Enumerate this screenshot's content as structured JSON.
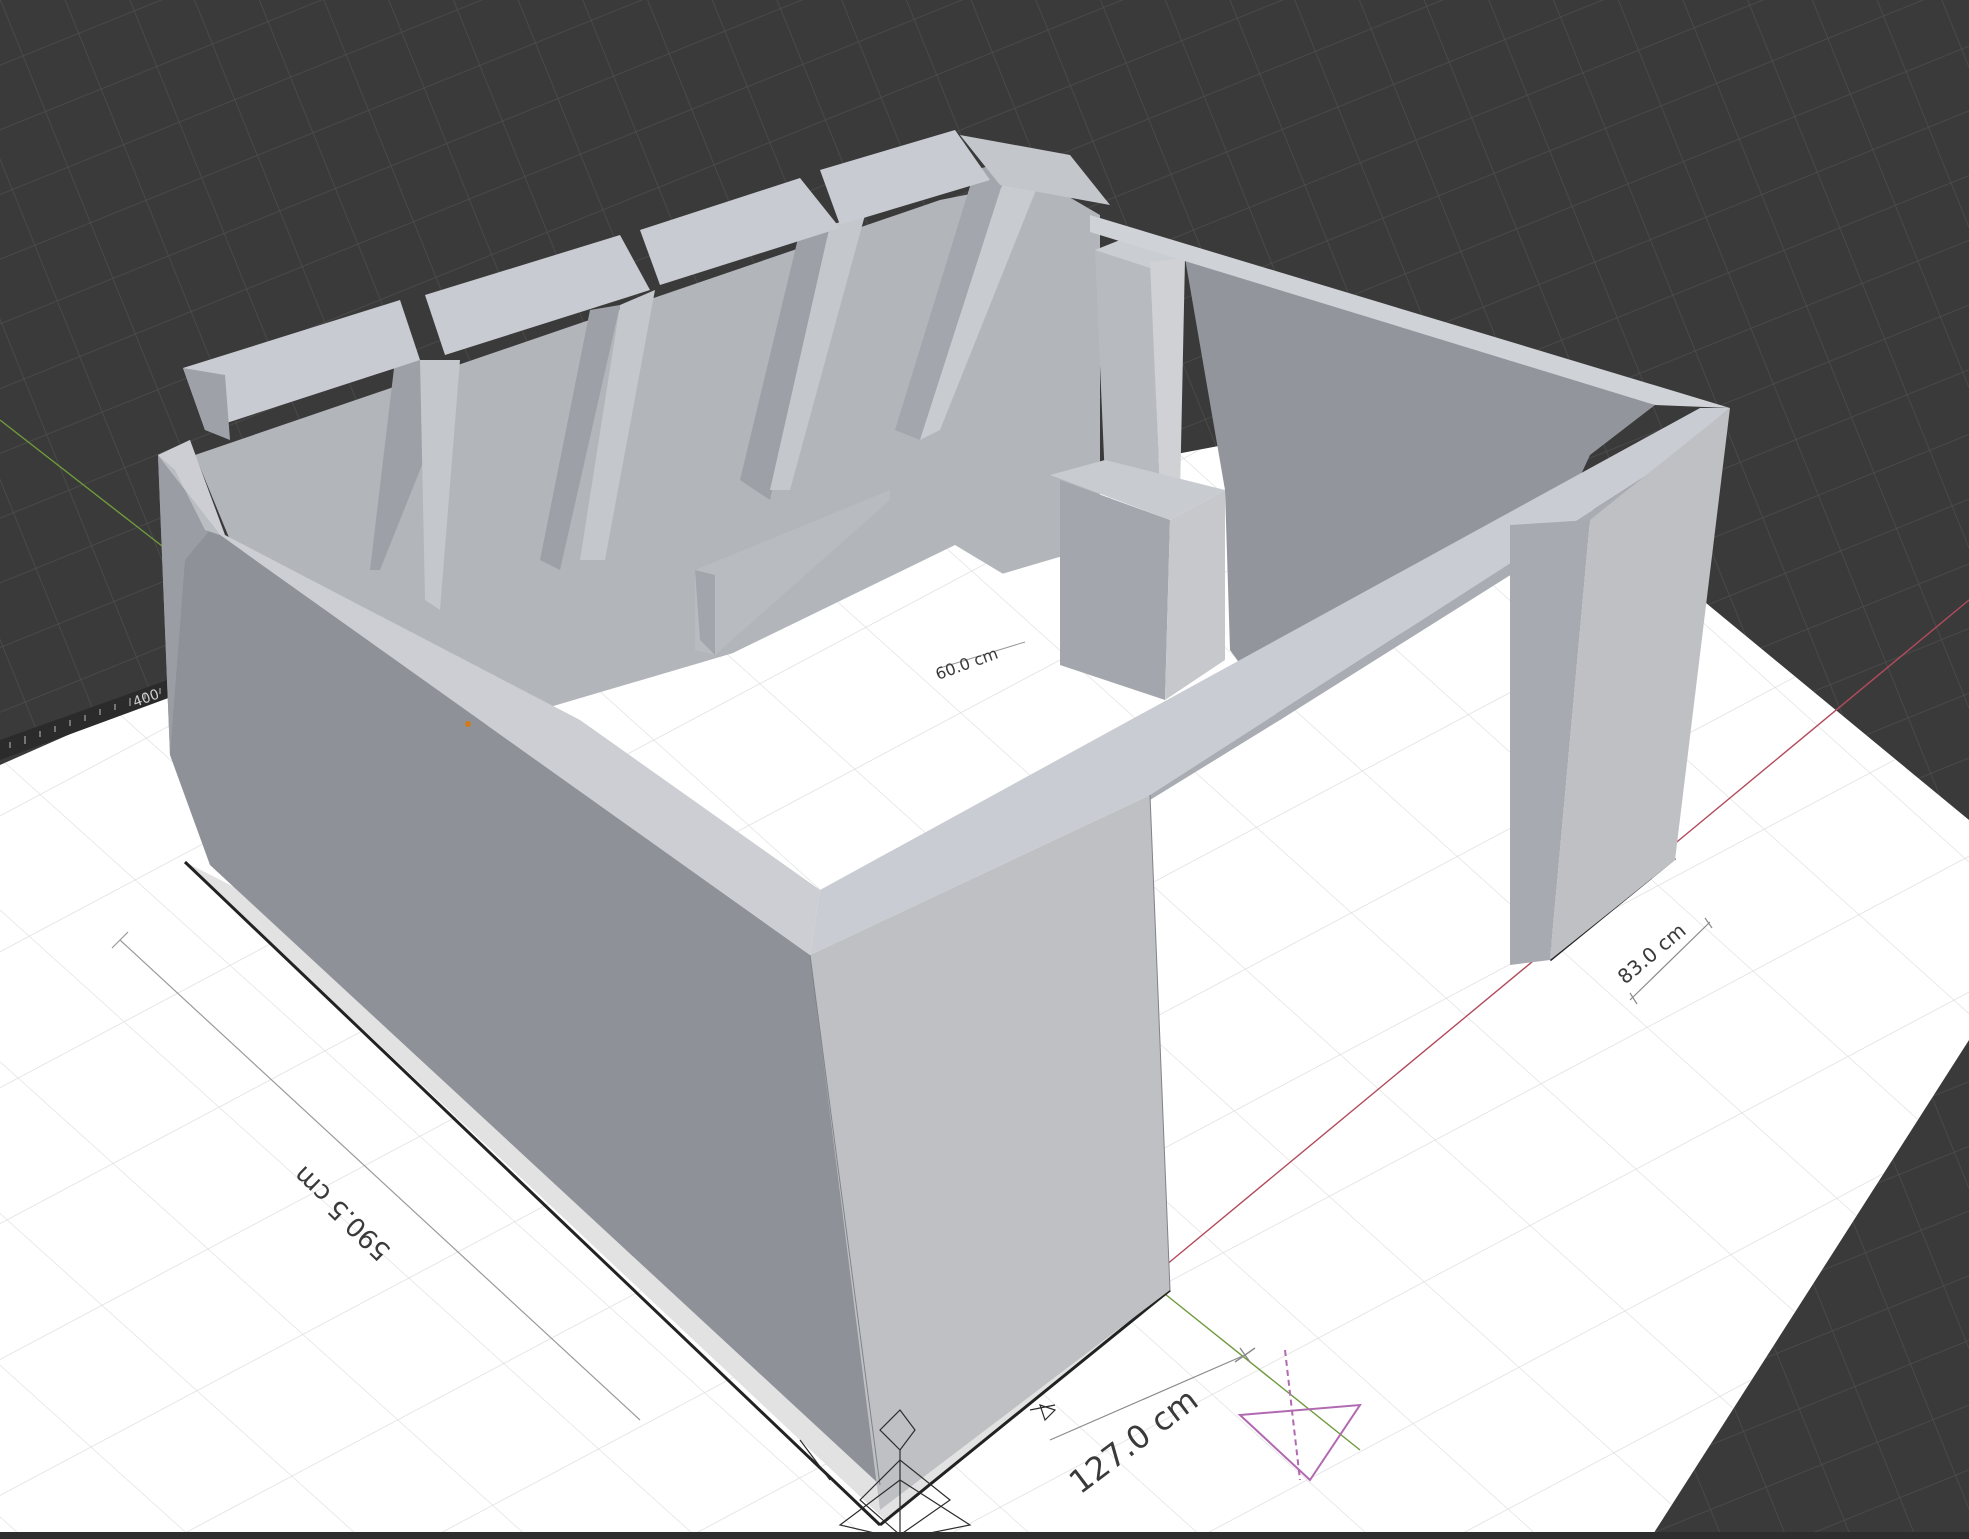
{
  "viewport": {
    "background": "#3a3a3a",
    "ground_color": "#ffffff",
    "wall_colors": {
      "front": "#8f939a",
      "side": "#bfc0c3",
      "top": "#c9ccd2",
      "inner": "#a7abb1"
    }
  },
  "dimensions": {
    "left_wall_length": "590.5 cm",
    "front_opening": "127.0 cm",
    "right_offset": "83.0 cm",
    "inner_gap": "60.0 cm"
  },
  "ruler": {
    "label": "400"
  },
  "gizmos": [
    "camera-icon",
    "axis-gizmo"
  ]
}
